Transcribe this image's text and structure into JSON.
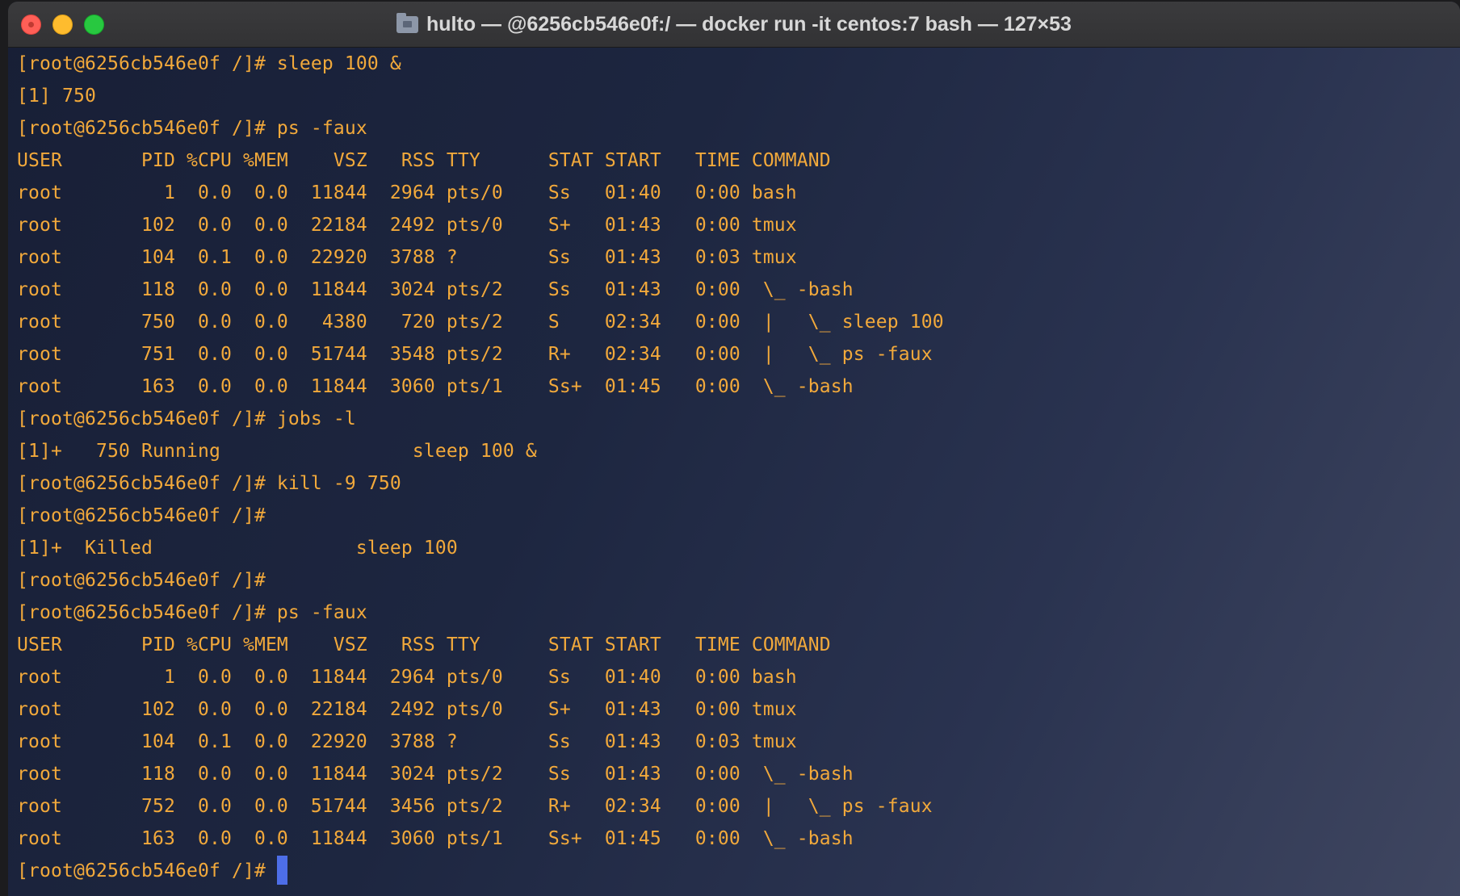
{
  "window": {
    "title": "hulto — @6256cb546e0f:/ — docker run -it centos:7 bash — 127×53",
    "title_icon": "folder-icon"
  },
  "colors": {
    "text": "#f2a93b",
    "cursor": "#4d6ee8",
    "background": "#1d2640"
  },
  "terminal": {
    "lines": [
      "[root@6256cb546e0f /]# sleep 100 &",
      "[1] 750",
      "[root@6256cb546e0f /]# ps -faux",
      "USER       PID %CPU %MEM    VSZ   RSS TTY      STAT START   TIME COMMAND",
      "root         1  0.0  0.0  11844  2964 pts/0    Ss   01:40   0:00 bash",
      "root       102  0.0  0.0  22184  2492 pts/0    S+   01:43   0:00 tmux",
      "root       104  0.1  0.0  22920  3788 ?        Ss   01:43   0:03 tmux",
      "root       118  0.0  0.0  11844  3024 pts/2    Ss   01:43   0:00  \\_ -bash",
      "root       750  0.0  0.0   4380   720 pts/2    S    02:34   0:00  |   \\_ sleep 100",
      "root       751  0.0  0.0  51744  3548 pts/2    R+   02:34   0:00  |   \\_ ps -faux",
      "root       163  0.0  0.0  11844  3060 pts/1    Ss+  01:45   0:00  \\_ -bash",
      "[root@6256cb546e0f /]# jobs -l",
      "[1]+   750 Running                 sleep 100 &",
      "[root@6256cb546e0f /]# kill -9 750",
      "[root@6256cb546e0f /]#",
      "[1]+  Killed                  sleep 100",
      "[root@6256cb546e0f /]#",
      "[root@6256cb546e0f /]# ps -faux",
      "USER       PID %CPU %MEM    VSZ   RSS TTY      STAT START   TIME COMMAND",
      "root         1  0.0  0.0  11844  2964 pts/0    Ss   01:40   0:00 bash",
      "root       102  0.0  0.0  22184  2492 pts/0    S+   01:43   0:00 tmux",
      "root       104  0.1  0.0  22920  3788 ?        Ss   01:43   0:03 tmux",
      "root       118  0.0  0.0  11844  3024 pts/2    Ss   01:43   0:00  \\_ -bash",
      "root       752  0.0  0.0  51744  3456 pts/2    R+   02:34   0:00  |   \\_ ps -faux",
      "root       163  0.0  0.0  11844  3060 pts/1    Ss+  01:45   0:00  \\_ -bash"
    ],
    "prompt": "[root@6256cb546e0f /]# "
  }
}
